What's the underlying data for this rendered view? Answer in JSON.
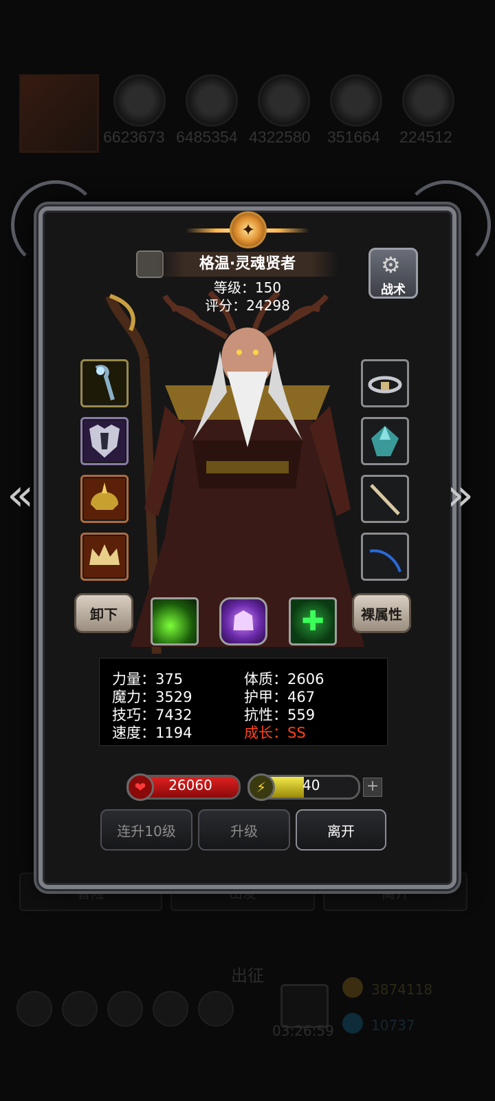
{
  "background": {
    "resources": [
      "6623673",
      "6485354",
      "4322580",
      "351664",
      "224512"
    ],
    "nav_buttons": [
      "冒险",
      "出发",
      "离开"
    ],
    "sortie_label": "出征",
    "timer": "03:26:59",
    "coins": "3874118",
    "gems": "10737"
  },
  "hero": {
    "name": "格温·灵魂贤者",
    "level_label": "等级：150",
    "score_label": "评分：24298"
  },
  "tactic_button": {
    "label": "战术"
  },
  "unequip_button": {
    "label": "卸下"
  },
  "base_attr_button": {
    "label": "裸属性"
  },
  "equipment": {
    "left": [
      "staff-icon",
      "armor-icon",
      "helmet-icon",
      "crown-icon"
    ],
    "right": [
      "ring-icon",
      "gem-icon",
      "bone-wand-icon",
      "blade-icon"
    ]
  },
  "skills": [
    "green-claw-icon",
    "purple-spirit-icon",
    "heal-cross-icon"
  ],
  "stats": {
    "strength": "力量：375",
    "constitution": "体质：2606",
    "magic": "魔力：3529",
    "armor": "护甲：467",
    "skill": "技巧：7432",
    "resistance": "抗性：559",
    "speed": "速度：1194",
    "growth": "成长：SS"
  },
  "bars": {
    "hp_value": "26060",
    "energy_value": "40",
    "energy_fraction": 0.5
  },
  "actions": {
    "level_up_10": "连升10级",
    "level_up": "升级",
    "leave": "离开"
  },
  "colors": {
    "growth_text": "#ff4418",
    "hp_bar": "#d01818",
    "energy_bar": "#e6dc3a"
  }
}
